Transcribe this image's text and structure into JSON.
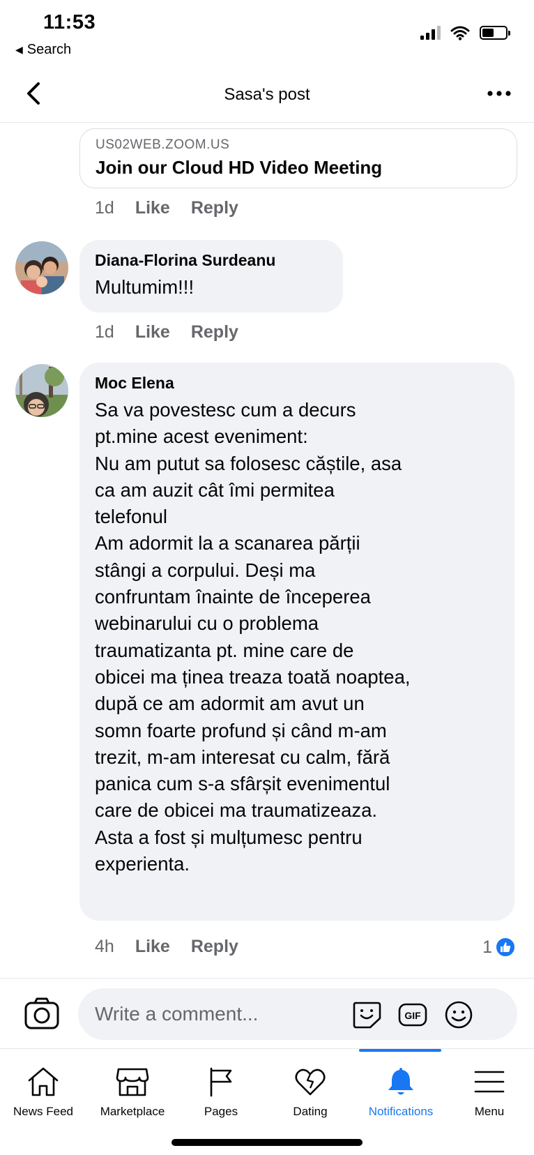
{
  "status_bar": {
    "time": "11:53",
    "back_app": "Search"
  },
  "header": {
    "title": "Sasa's post"
  },
  "link_card": {
    "domain": "US02WEB.ZOOM.US",
    "title": "Join our Cloud HD Video Meeting"
  },
  "link_meta": {
    "time": "1d",
    "like": "Like",
    "reply": "Reply"
  },
  "comments": [
    {
      "author": "Diana-Florina Surdeanu",
      "text": "Multumim!!!",
      "time": "1d",
      "like": "Like",
      "reply": "Reply"
    },
    {
      "author": "Moc Elena",
      "text": "Sa va povestesc cum a decurs\npt.mine acest eveniment:\nNu am putut sa folosesc căștile, asa\nca am auzit cât îmi permitea\ntelefonul\nAm adormit la a scanarea părții\nstângi a corpului. Deși ma\nconfruntam înainte de începerea\nwebinarului cu o problema\ntraumatizanta pt. mine care de\nobicei ma ținea treaza toată noaptea,\ndupă ce am adormit am avut un\nsomn foarte profund și când m-am\ntrezit, m-am interesat cu calm, fără\npanica cum s-a sfârșit evenimentul\ncare de obicei ma traumatizeaza.\nAsta a fost și mulțumesc pentru\nexperienta.",
      "time": "4h",
      "like": "Like",
      "reply": "Reply",
      "reaction_count": "1"
    }
  ],
  "composer": {
    "placeholder": "Write a comment...",
    "icons": [
      "camera-icon",
      "sticker-icon",
      "gif-icon",
      "emoji-icon"
    ]
  },
  "bottom_nav": {
    "items": [
      {
        "label": "News Feed",
        "icon": "home-icon"
      },
      {
        "label": "Marketplace",
        "icon": "shop-icon"
      },
      {
        "label": "Pages",
        "icon": "flag-icon"
      },
      {
        "label": "Dating",
        "icon": "heart-icon"
      },
      {
        "label": "Notifications",
        "icon": "bell-icon",
        "active": true
      },
      {
        "label": "Menu",
        "icon": "menu-icon"
      }
    ]
  },
  "colors": {
    "accent": "#1877f2",
    "bubble": "#f0f2f5",
    "secondary_text": "#65676b"
  }
}
